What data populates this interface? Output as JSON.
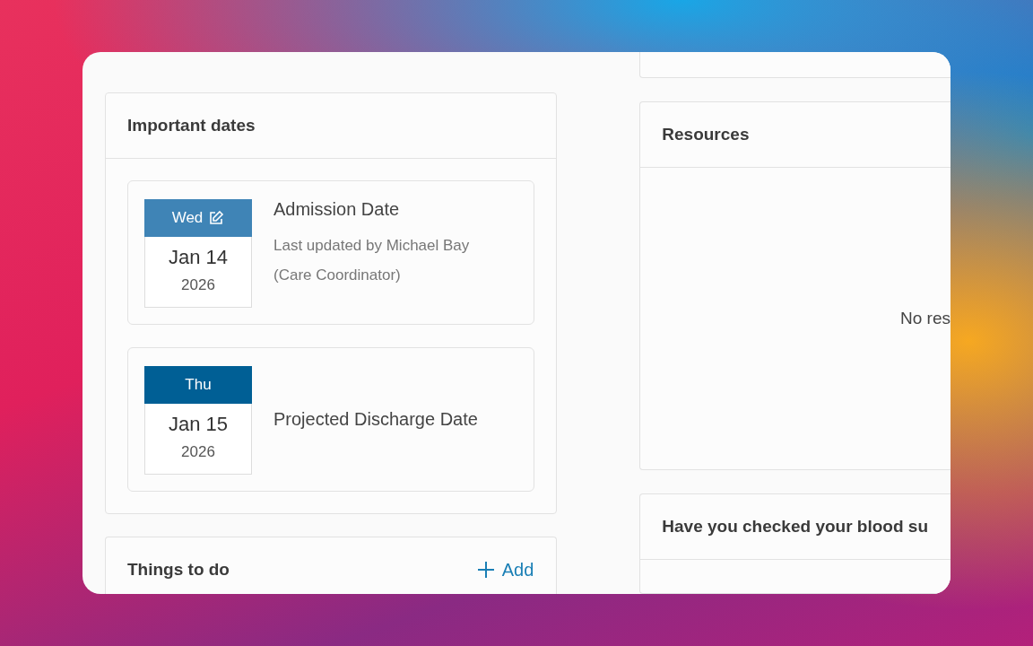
{
  "important_dates": {
    "title": "Important dates",
    "items": [
      {
        "weekday": "Wed",
        "date": "Jan 14",
        "year": "2026",
        "label": "Admission Date",
        "note": "Last updated by Michael Bay (Care Coordinator)",
        "editing": true
      },
      {
        "weekday": "Thu",
        "date": "Jan 15",
        "year": "2026",
        "label": "Projected Discharge Date",
        "editing": false
      }
    ]
  },
  "things_to_do": {
    "title": "Things to do",
    "add_button": "Add"
  },
  "resources": {
    "title": "Resources",
    "empty_text": "No res"
  },
  "question_card": {
    "title": "Have you checked your blood su"
  }
}
